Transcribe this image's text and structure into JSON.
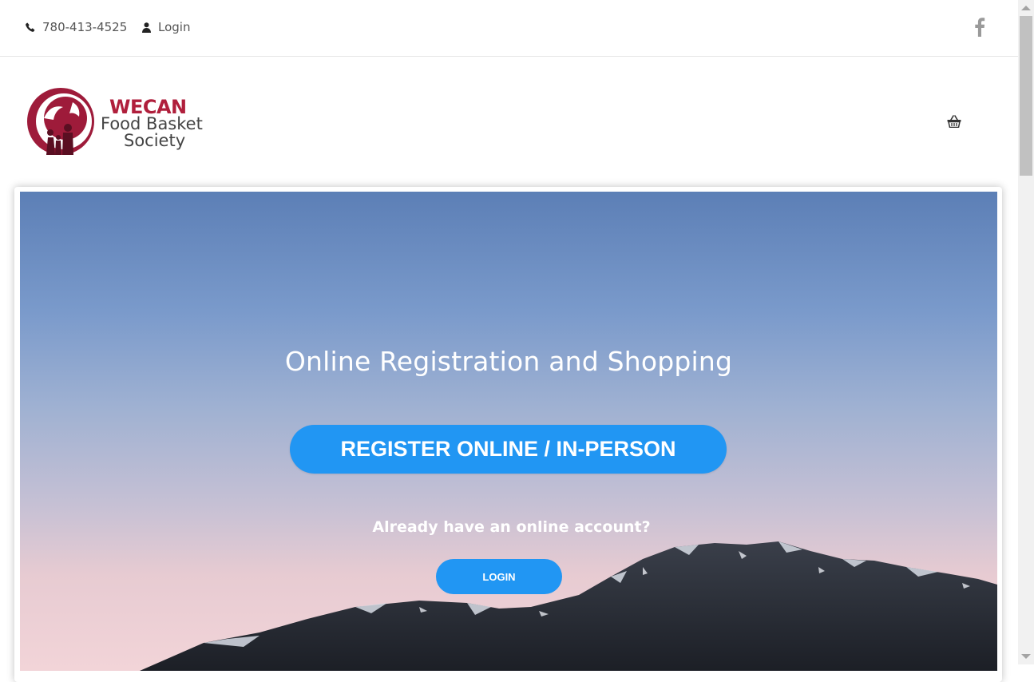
{
  "topbar": {
    "phone": "780-413-4525",
    "login": "Login",
    "phone_icon": "phone-icon",
    "user_icon": "user-icon",
    "social_icon": "facebook-icon"
  },
  "logo": {
    "name": "WECAN",
    "line2": "Food Basket",
    "line3": "Society",
    "brand_color": "#b01f3c"
  },
  "header": {
    "cart_icon": "basket-icon"
  },
  "hero": {
    "title": "Online Registration and Shopping",
    "register_button": "REGISTER ONLINE / IN-PERSON",
    "already_text": "Already have an online account?",
    "login_button": "LOGIN",
    "accent_color": "#2196f3"
  }
}
